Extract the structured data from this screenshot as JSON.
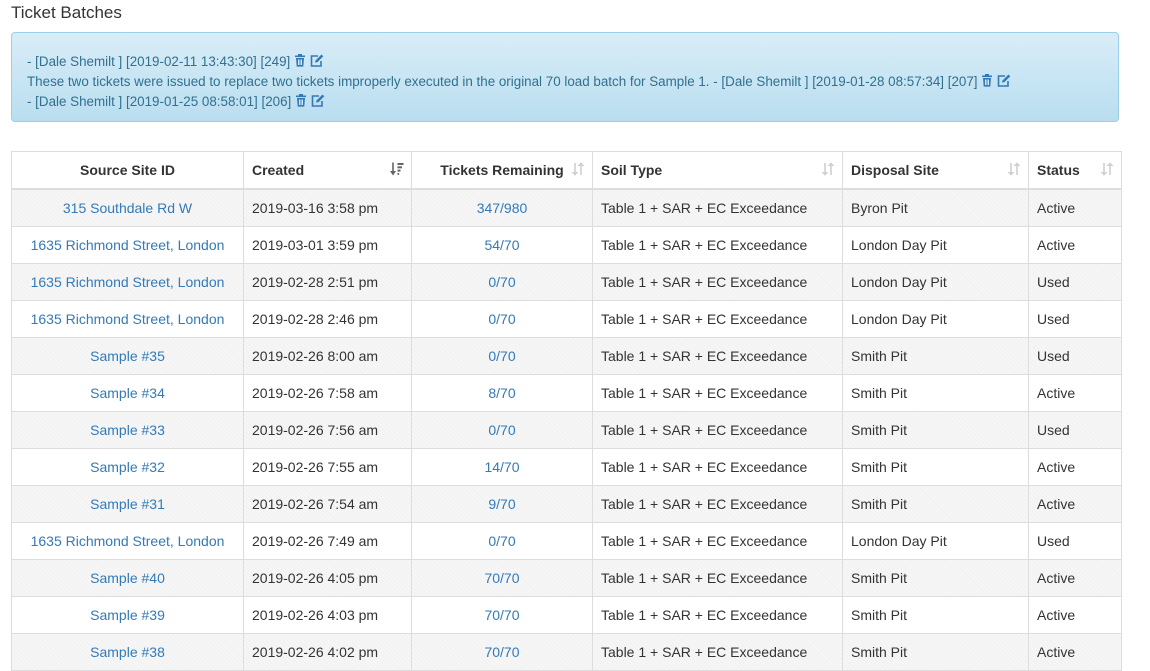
{
  "page": {
    "title": "Ticket Batches"
  },
  "notes": [
    {
      "text": "- [Dale Shemilt ] [2019-02-11 13:43:30] [249]"
    },
    {
      "text": "These two tickets were issued to replace two tickets improperly executed in the original 70 load batch for Sample 1. - [Dale Shemilt ] [2019-01-28 08:57:34] [207]"
    },
    {
      "text": "- [Dale Shemilt ] [2019-01-25 08:58:01] [206]"
    }
  ],
  "icons": {
    "delete": "trash-icon",
    "edit": "edit-icon",
    "sort": "sort-icon",
    "sort_active": "sort-desc-icon"
  },
  "colors": {
    "link": "#337ab7",
    "note_bg": "#d9edf7",
    "note_text": "#31708f"
  },
  "table": {
    "columns": [
      "Source Site ID",
      "Created",
      "Tickets Remaining",
      "Soil Type",
      "Disposal Site",
      "Status"
    ],
    "rows": [
      [
        "315 Southdale Rd W",
        "2019-03-16 3:58 pm",
        "347/980",
        "Table 1 + SAR + EC Exceedance",
        "Byron Pit",
        "Active"
      ],
      [
        "1635 Richmond Street, London",
        "2019-03-01 3:59 pm",
        "54/70",
        "Table 1 + SAR + EC Exceedance",
        "London Day Pit",
        "Active"
      ],
      [
        "1635 Richmond Street, London",
        "2019-02-28 2:51 pm",
        "0/70",
        "Table 1 + SAR + EC Exceedance",
        "London Day Pit",
        "Used"
      ],
      [
        "1635 Richmond Street, London",
        "2019-02-28 2:46 pm",
        "0/70",
        "Table 1 + SAR + EC Exceedance",
        "London Day Pit",
        "Used"
      ],
      [
        "Sample #35",
        "2019-02-26 8:00 am",
        "0/70",
        "Table 1 + SAR + EC Exceedance",
        "Smith Pit",
        "Used"
      ],
      [
        "Sample #34",
        "2019-02-26 7:58 am",
        "8/70",
        "Table 1 + SAR + EC Exceedance",
        "Smith Pit",
        "Active"
      ],
      [
        "Sample #33",
        "2019-02-26 7:56 am",
        "0/70",
        "Table 1 + SAR + EC Exceedance",
        "Smith Pit",
        "Used"
      ],
      [
        "Sample #32",
        "2019-02-26 7:55 am",
        "14/70",
        "Table 1 + SAR + EC Exceedance",
        "Smith Pit",
        "Active"
      ],
      [
        "Sample #31",
        "2019-02-26 7:54 am",
        "9/70",
        "Table 1 + SAR + EC Exceedance",
        "Smith Pit",
        "Active"
      ],
      [
        "1635 Richmond Street, London",
        "2019-02-26 7:49 am",
        "0/70",
        "Table 1 + SAR + EC Exceedance",
        "London Day Pit",
        "Used"
      ],
      [
        "Sample #40",
        "2019-02-26 4:05 pm",
        "70/70",
        "Table 1 + SAR + EC Exceedance",
        "Smith Pit",
        "Active"
      ],
      [
        "Sample #39",
        "2019-02-26 4:03 pm",
        "70/70",
        "Table 1 + SAR + EC Exceedance",
        "Smith Pit",
        "Active"
      ],
      [
        "Sample #38",
        "2019-02-26 4:02 pm",
        "70/70",
        "Table 1 + SAR + EC Exceedance",
        "Smith Pit",
        "Active"
      ]
    ]
  }
}
